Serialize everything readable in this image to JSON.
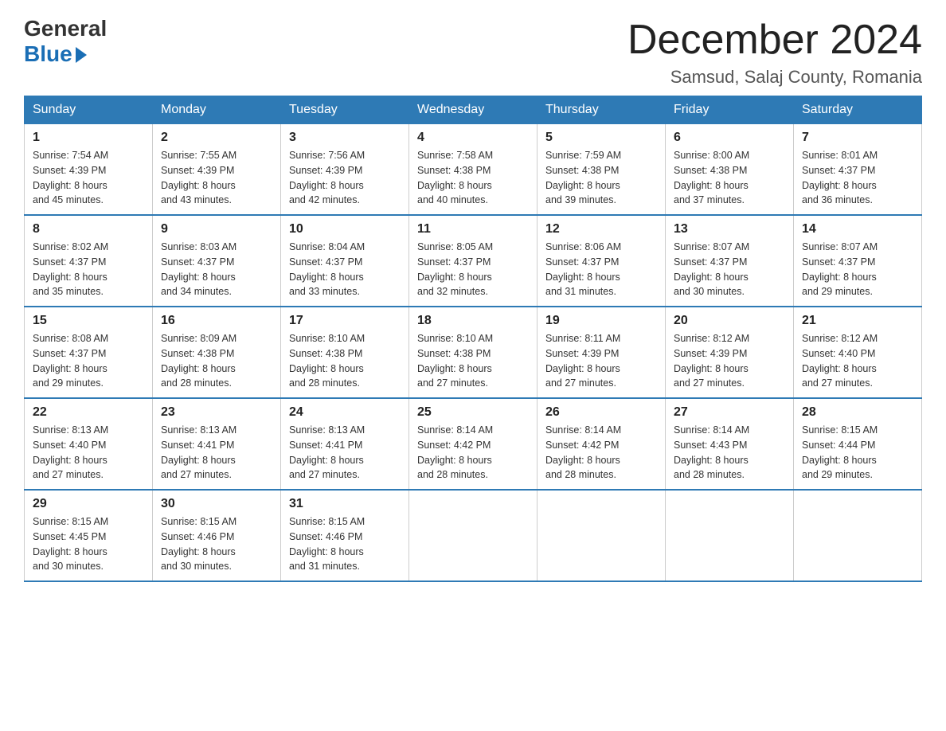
{
  "logo": {
    "general": "General",
    "blue": "Blue"
  },
  "title": "December 2024",
  "location": "Samsud, Salaj County, Romania",
  "days_of_week": [
    "Sunday",
    "Monday",
    "Tuesday",
    "Wednesday",
    "Thursday",
    "Friday",
    "Saturday"
  ],
  "weeks": [
    [
      {
        "day": "1",
        "sunrise": "7:54 AM",
        "sunset": "4:39 PM",
        "daylight": "8 hours and 45 minutes."
      },
      {
        "day": "2",
        "sunrise": "7:55 AM",
        "sunset": "4:39 PM",
        "daylight": "8 hours and 43 minutes."
      },
      {
        "day": "3",
        "sunrise": "7:56 AM",
        "sunset": "4:39 PM",
        "daylight": "8 hours and 42 minutes."
      },
      {
        "day": "4",
        "sunrise": "7:58 AM",
        "sunset": "4:38 PM",
        "daylight": "8 hours and 40 minutes."
      },
      {
        "day": "5",
        "sunrise": "7:59 AM",
        "sunset": "4:38 PM",
        "daylight": "8 hours and 39 minutes."
      },
      {
        "day": "6",
        "sunrise": "8:00 AM",
        "sunset": "4:38 PM",
        "daylight": "8 hours and 37 minutes."
      },
      {
        "day": "7",
        "sunrise": "8:01 AM",
        "sunset": "4:37 PM",
        "daylight": "8 hours and 36 minutes."
      }
    ],
    [
      {
        "day": "8",
        "sunrise": "8:02 AM",
        "sunset": "4:37 PM",
        "daylight": "8 hours and 35 minutes."
      },
      {
        "day": "9",
        "sunrise": "8:03 AM",
        "sunset": "4:37 PM",
        "daylight": "8 hours and 34 minutes."
      },
      {
        "day": "10",
        "sunrise": "8:04 AM",
        "sunset": "4:37 PM",
        "daylight": "8 hours and 33 minutes."
      },
      {
        "day": "11",
        "sunrise": "8:05 AM",
        "sunset": "4:37 PM",
        "daylight": "8 hours and 32 minutes."
      },
      {
        "day": "12",
        "sunrise": "8:06 AM",
        "sunset": "4:37 PM",
        "daylight": "8 hours and 31 minutes."
      },
      {
        "day": "13",
        "sunrise": "8:07 AM",
        "sunset": "4:37 PM",
        "daylight": "8 hours and 30 minutes."
      },
      {
        "day": "14",
        "sunrise": "8:07 AM",
        "sunset": "4:37 PM",
        "daylight": "8 hours and 29 minutes."
      }
    ],
    [
      {
        "day": "15",
        "sunrise": "8:08 AM",
        "sunset": "4:37 PM",
        "daylight": "8 hours and 29 minutes."
      },
      {
        "day": "16",
        "sunrise": "8:09 AM",
        "sunset": "4:38 PM",
        "daylight": "8 hours and 28 minutes."
      },
      {
        "day": "17",
        "sunrise": "8:10 AM",
        "sunset": "4:38 PM",
        "daylight": "8 hours and 28 minutes."
      },
      {
        "day": "18",
        "sunrise": "8:10 AM",
        "sunset": "4:38 PM",
        "daylight": "8 hours and 27 minutes."
      },
      {
        "day": "19",
        "sunrise": "8:11 AM",
        "sunset": "4:39 PM",
        "daylight": "8 hours and 27 minutes."
      },
      {
        "day": "20",
        "sunrise": "8:12 AM",
        "sunset": "4:39 PM",
        "daylight": "8 hours and 27 minutes."
      },
      {
        "day": "21",
        "sunrise": "8:12 AM",
        "sunset": "4:40 PM",
        "daylight": "8 hours and 27 minutes."
      }
    ],
    [
      {
        "day": "22",
        "sunrise": "8:13 AM",
        "sunset": "4:40 PM",
        "daylight": "8 hours and 27 minutes."
      },
      {
        "day": "23",
        "sunrise": "8:13 AM",
        "sunset": "4:41 PM",
        "daylight": "8 hours and 27 minutes."
      },
      {
        "day": "24",
        "sunrise": "8:13 AM",
        "sunset": "4:41 PM",
        "daylight": "8 hours and 27 minutes."
      },
      {
        "day": "25",
        "sunrise": "8:14 AM",
        "sunset": "4:42 PM",
        "daylight": "8 hours and 28 minutes."
      },
      {
        "day": "26",
        "sunrise": "8:14 AM",
        "sunset": "4:42 PM",
        "daylight": "8 hours and 28 minutes."
      },
      {
        "day": "27",
        "sunrise": "8:14 AM",
        "sunset": "4:43 PM",
        "daylight": "8 hours and 28 minutes."
      },
      {
        "day": "28",
        "sunrise": "8:15 AM",
        "sunset": "4:44 PM",
        "daylight": "8 hours and 29 minutes."
      }
    ],
    [
      {
        "day": "29",
        "sunrise": "8:15 AM",
        "sunset": "4:45 PM",
        "daylight": "8 hours and 30 minutes."
      },
      {
        "day": "30",
        "sunrise": "8:15 AM",
        "sunset": "4:46 PM",
        "daylight": "8 hours and 30 minutes."
      },
      {
        "day": "31",
        "sunrise": "8:15 AM",
        "sunset": "4:46 PM",
        "daylight": "8 hours and 31 minutes."
      },
      null,
      null,
      null,
      null
    ]
  ],
  "labels": {
    "sunrise": "Sunrise:",
    "sunset": "Sunset:",
    "daylight": "Daylight:"
  }
}
